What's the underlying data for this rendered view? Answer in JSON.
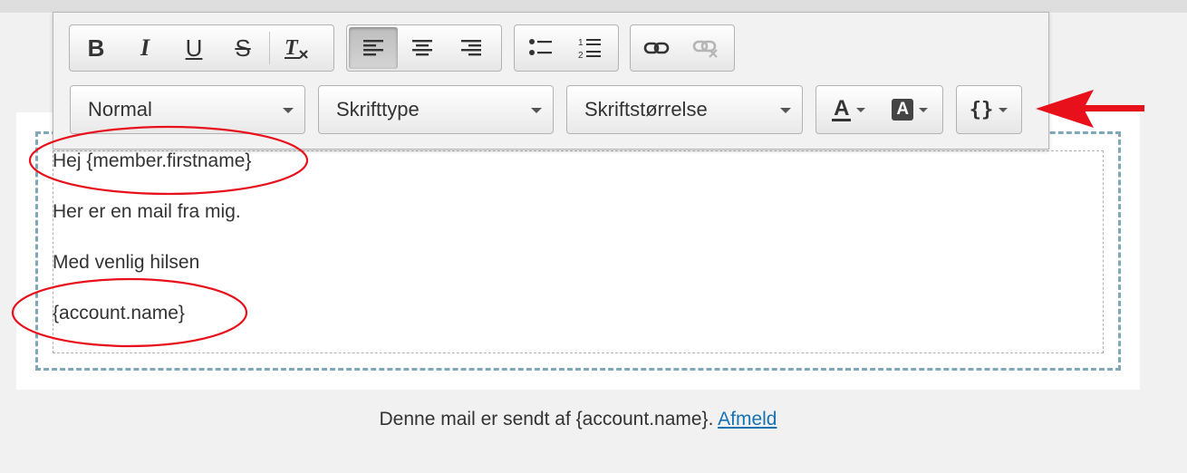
{
  "toolbar": {
    "format_buttons": [
      {
        "name": "bold-button",
        "icon": "bold-icon",
        "glyph": "B"
      },
      {
        "name": "italic-button",
        "icon": "italic-icon",
        "glyph": "I"
      },
      {
        "name": "underline-button",
        "icon": "underline-icon",
        "glyph": "U"
      },
      {
        "name": "strikethrough-button",
        "icon": "strikethrough-icon",
        "glyph": "S"
      },
      {
        "name": "remove-format-button",
        "icon": "clear-format-icon",
        "glyph": "Tx"
      }
    ],
    "align_buttons": [
      {
        "name": "align-left-button",
        "icon": "align-left-icon",
        "active": true
      },
      {
        "name": "align-center-button",
        "icon": "align-center-icon",
        "active": false
      },
      {
        "name": "align-right-button",
        "icon": "align-right-icon",
        "active": false
      }
    ],
    "list_buttons": [
      {
        "name": "bulleted-list-button",
        "icon": "bulleted-list-icon"
      },
      {
        "name": "numbered-list-button",
        "icon": "numbered-list-icon"
      }
    ],
    "link_buttons": [
      {
        "name": "link-button",
        "icon": "link-icon",
        "enabled": true
      },
      {
        "name": "unlink-button",
        "icon": "unlink-icon",
        "enabled": false
      }
    ],
    "paragraph_format": "Normal",
    "font_family": "Skrifttype",
    "font_size": "Skriftstørrelse",
    "text_color_glyph": "A",
    "bg_color_glyph": "A",
    "placeholder_glyph": "{}"
  },
  "editor": {
    "lines": [
      "Hej {member.firstname}",
      "Her er en mail fra mig.",
      "Med venlig hilsen",
      "{account.name}"
    ]
  },
  "footer": {
    "text": "Denne mail er sendt af {account.name}.",
    "link_label": "Afmeld"
  },
  "annotations": {
    "color": "#e8111b"
  }
}
